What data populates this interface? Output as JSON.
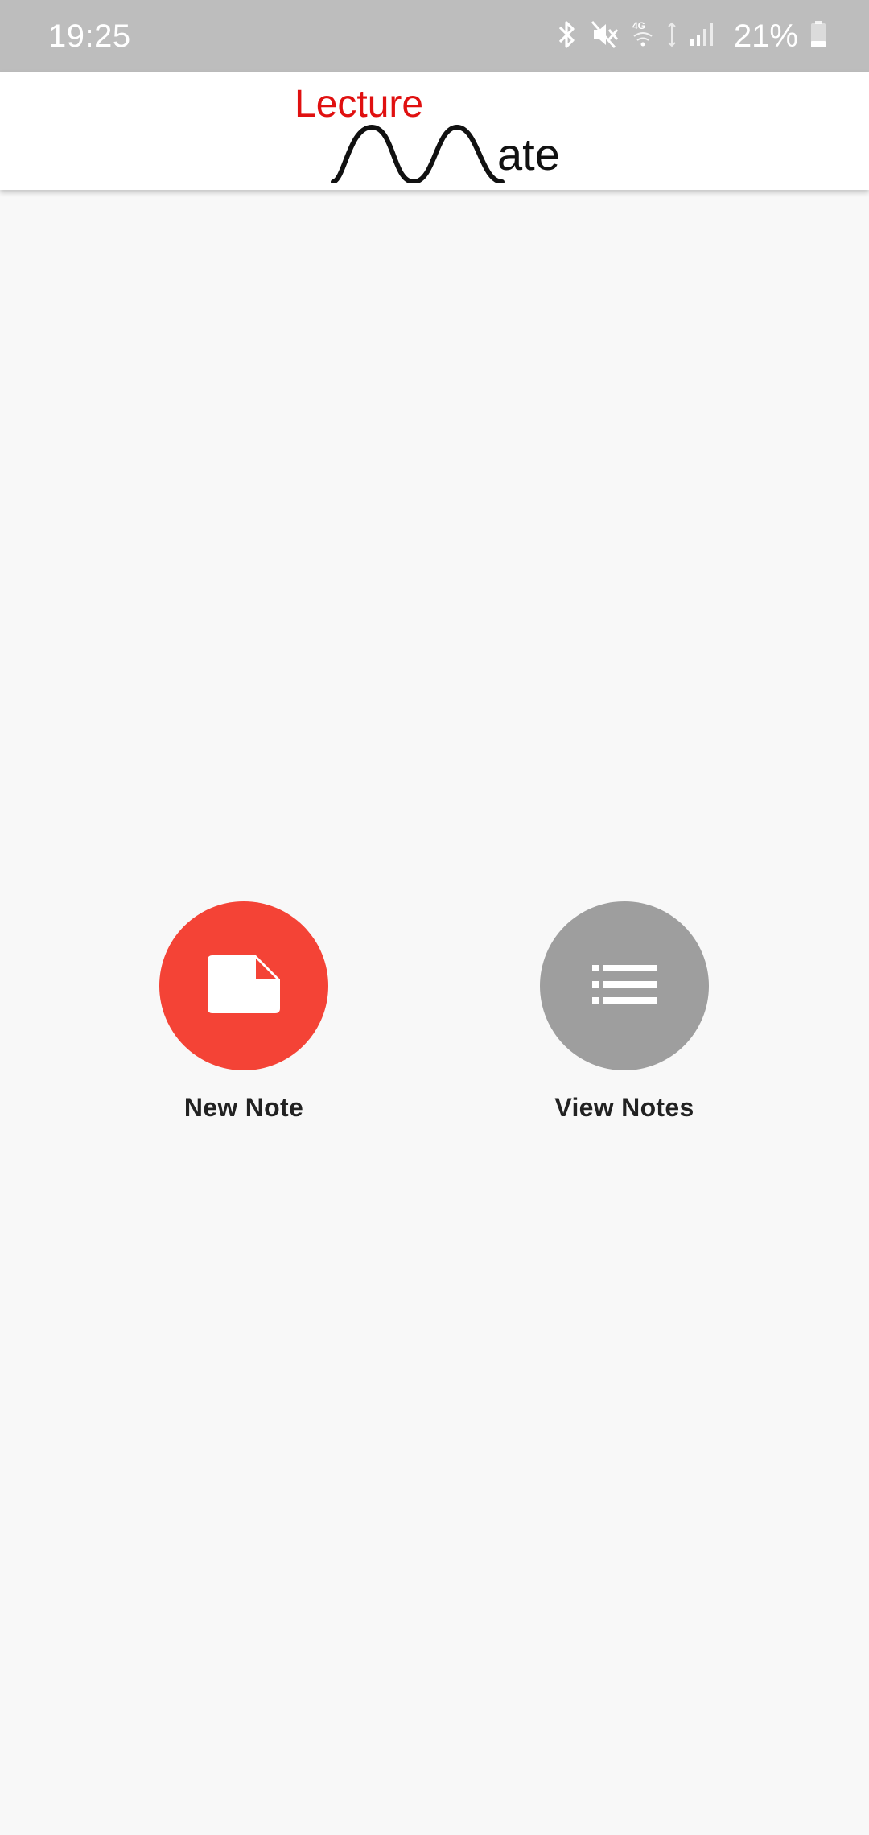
{
  "status_bar": {
    "time": "19:25",
    "battery_text": "21%",
    "icons": [
      "bluetooth-icon",
      "mute-icon",
      "4g-icon",
      "signal-icon",
      "battery-icon"
    ]
  },
  "app_bar": {
    "logo_word_top": "Lecture",
    "logo_word_bottom": "ate"
  },
  "actions": {
    "new_note": {
      "label": "New Note",
      "icon": "note-icon",
      "color": "#f44336"
    },
    "view_notes": {
      "label": "View Notes",
      "icon": "list-icon",
      "color": "#9e9e9e"
    }
  },
  "colors": {
    "status_bar": "#bdbdbd",
    "background": "#f8f8f8",
    "brand_red": "#e01010"
  }
}
